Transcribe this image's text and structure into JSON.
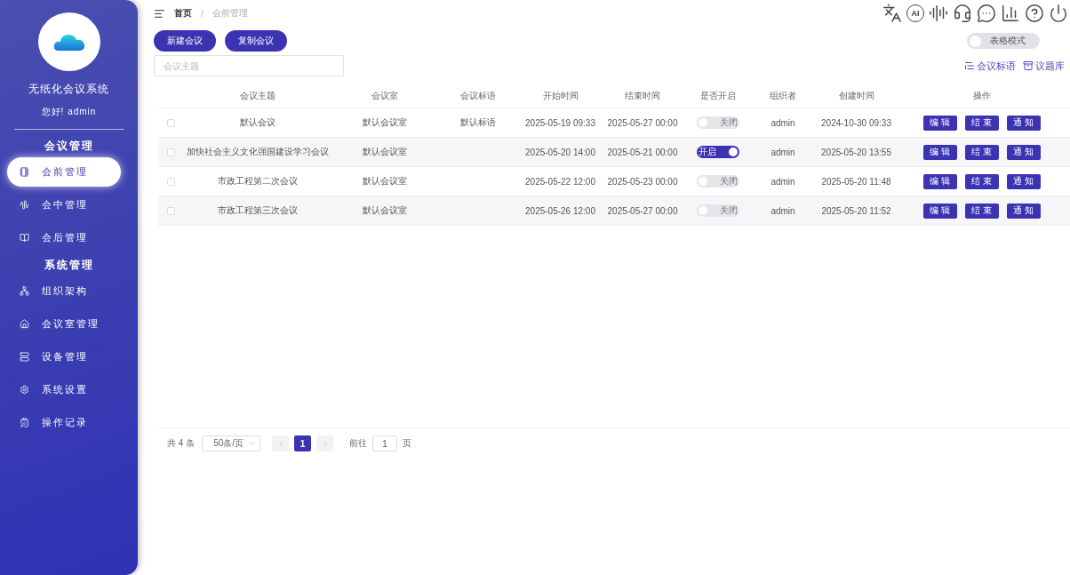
{
  "sidebar": {
    "title": "无纸化会议系统",
    "greeting": "您好! admin",
    "groups": [
      {
        "heading": "会议管理",
        "items": [
          {
            "label": "会前管理",
            "selected": true
          },
          {
            "label": "会中管理",
            "selected": false
          },
          {
            "label": "会后管理",
            "selected": false
          }
        ]
      },
      {
        "heading": "系统管理",
        "items": [
          {
            "label": "组织架构",
            "selected": false
          },
          {
            "label": "会议室管理",
            "selected": false
          },
          {
            "label": "设备管理",
            "selected": false
          },
          {
            "label": "系统设置",
            "selected": false
          },
          {
            "label": "操作记录",
            "selected": false
          }
        ]
      }
    ]
  },
  "breadcrumb": [
    {
      "label": "首页",
      "current": false
    },
    {
      "label": "会前管理",
      "current": true
    }
  ],
  "breadcrumb_separator": "/",
  "header_icons": [
    {
      "kind": "translate"
    },
    {
      "kind": "ai",
      "label": "AI"
    },
    {
      "kind": "voice"
    },
    {
      "kind": "service"
    },
    {
      "kind": "chat"
    },
    {
      "kind": "chart"
    },
    {
      "kind": "help"
    },
    {
      "kind": "power"
    }
  ],
  "buttons": [
    "新建会议",
    "复制会议"
  ],
  "table_mode": {
    "label": "表格模式",
    "on": false
  },
  "search": {
    "placeholder": "会议主题"
  },
  "links": [
    "会议标语",
    "议题库"
  ],
  "table": {
    "columns": [
      "会议主题",
      "会议室",
      "会议标语",
      "开始时间",
      "结束时间",
      "是否开启",
      "组织者",
      "创建时间",
      "操作"
    ],
    "rows": [
      {
        "checked": false,
        "topic": "默认会议",
        "room": "默认会议室",
        "slogan": "默认标语",
        "start": "2025-05-19 09:33",
        "end": "2025-05-27 00:00",
        "open": {
          "on": false,
          "label": "关闭"
        },
        "organizer": "admin",
        "created": "2024-10-30 09:33",
        "actions": [
          "编 辑",
          "结 束",
          "通 知"
        ]
      },
      {
        "checked": false,
        "topic": "加快社会主义文化强国建设学习会议",
        "room": "默认会议室",
        "start": "2025-05-20 14:00",
        "end": "2025-05-21 00:00",
        "open": {
          "on": true,
          "label": "开启"
        },
        "organizer": "admin",
        "created": "2025-05-20 13:55",
        "actions": [
          "编 辑",
          "结 束",
          "通 知"
        ]
      },
      {
        "checked": false,
        "topic": "市政工程第二次会议",
        "room": "默认会议室",
        "start": "2025-05-22 12:00",
        "end": "2025-05-23 00:00",
        "open": {
          "on": false,
          "label": "关闭"
        },
        "organizer": "admin",
        "created": "2025-05-20 11:48",
        "actions": [
          "编 辑",
          "结 束",
          "通 知"
        ]
      },
      {
        "checked": false,
        "topic": "市政工程第三次会议",
        "room": "默认会议室",
        "start": "2025-05-26 12:00",
        "end": "2025-05-27 00:00",
        "open": {
          "on": false,
          "label": "关闭"
        },
        "organizer": "admin",
        "created": "2025-05-20 11:52",
        "actions": [
          "编 辑",
          "结 束",
          "通 知"
        ]
      }
    ]
  },
  "pagination": {
    "total": "共 4 条",
    "page_size": "50条/页",
    "pages": [
      {
        "label": "1",
        "selected": true
      }
    ],
    "goto_label": "前往",
    "goto_value": "1",
    "goto_suffix": "页"
  }
}
